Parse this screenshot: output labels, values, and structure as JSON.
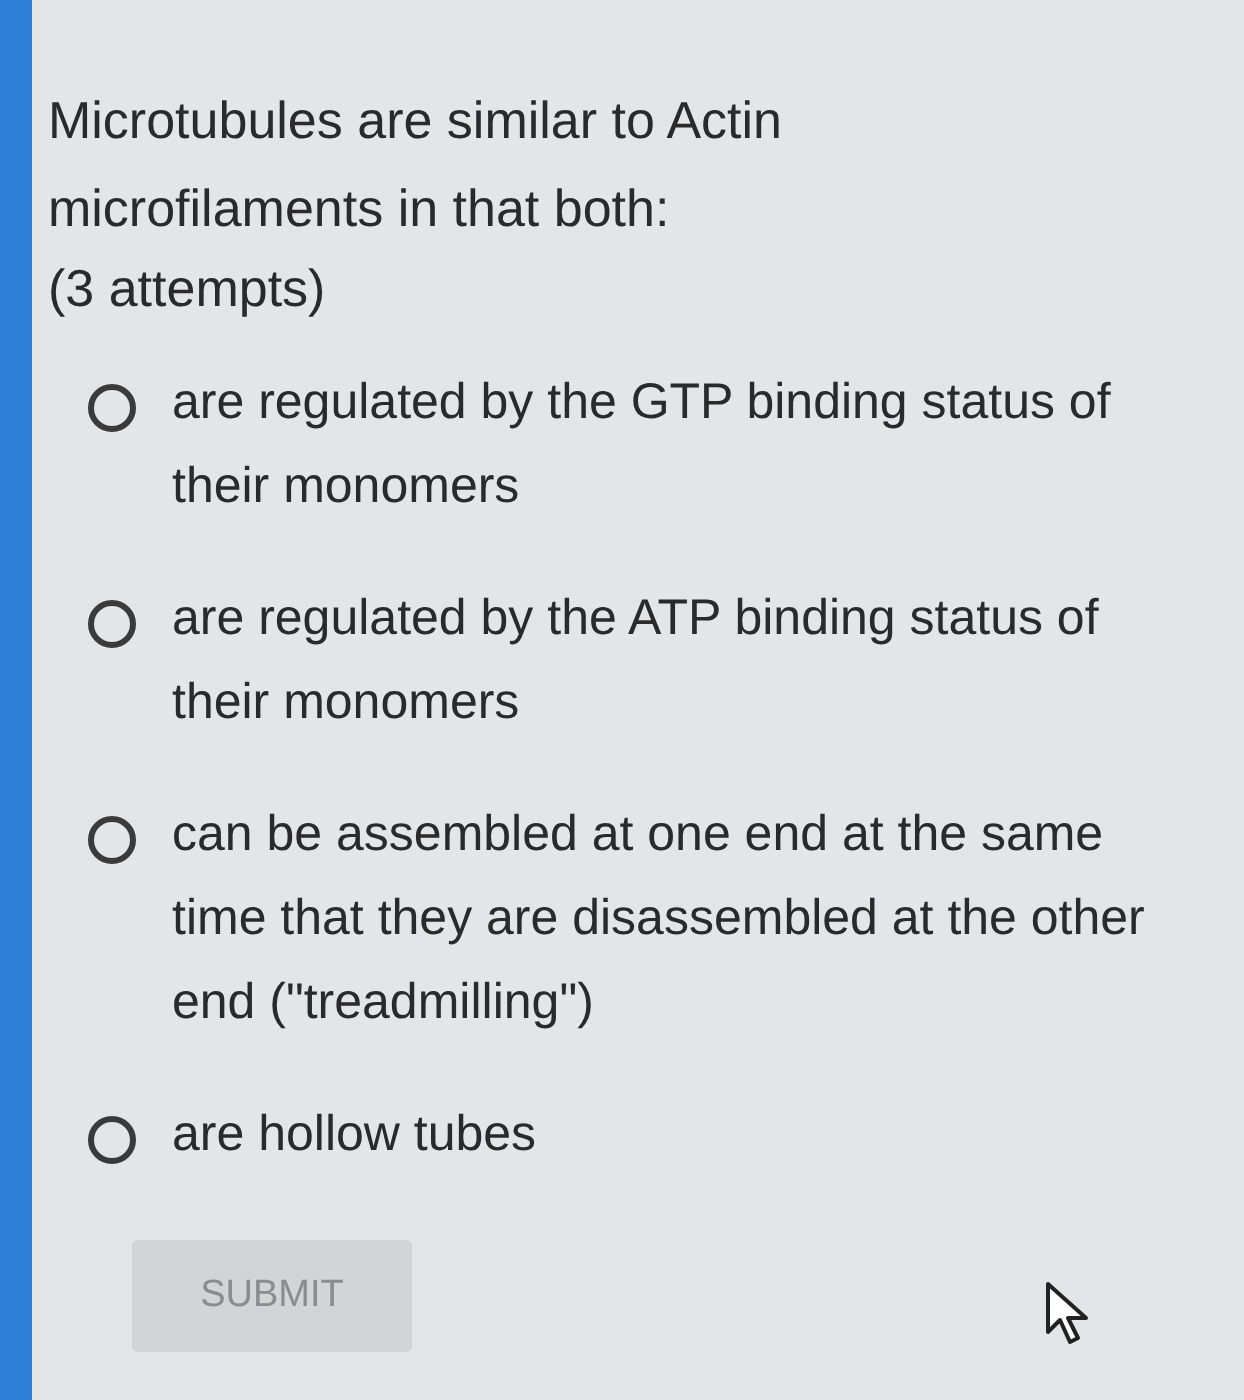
{
  "question": {
    "lines": [
      "Microtubules are similar to Actin",
      "microfilaments in that both:"
    ],
    "attempts": "(3 attempts)"
  },
  "options": [
    {
      "label": "are regulated by the GTP binding status of their monomers",
      "selected": false
    },
    {
      "label": "are regulated by the ATP binding status of their monomers",
      "selected": false
    },
    {
      "label": "can be assembled at one end at the same time that they are disassembled at the other end (\"treadmilling\")",
      "selected": false
    },
    {
      "label": "are hollow tubes",
      "selected": false
    }
  ],
  "submit": {
    "label": "SUBMIT",
    "disabled": true
  }
}
